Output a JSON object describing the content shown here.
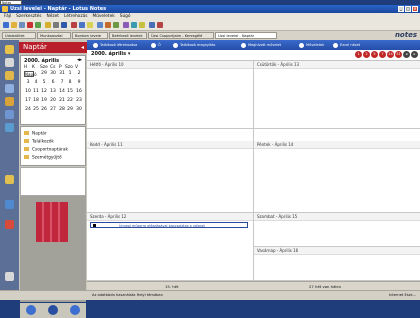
{
  "corner_label": "Notes",
  "window": {
    "title": "Uzsi levelei - Naptár - Lotus Notes"
  },
  "menu": [
    "Fájl",
    "Szerkesztés",
    "Nézet",
    "Létrehozás",
    "Műveletek",
    "Súgó"
  ],
  "tabs": [
    {
      "label": "Üdvözöllek",
      "active": false
    },
    {
      "label": "Munkaasztal",
      "active": false
    },
    {
      "label": "Bontom levele",
      "active": false
    },
    {
      "label": "Beérkező levelek",
      "active": false
    },
    {
      "label": "Üzsi Csoportjaim - Keresgélé",
      "active": false
    },
    {
      "label": "Uzsi levelei - Naptár",
      "active": true
    }
  ],
  "logo": "notes",
  "sidebar": {
    "title": "Naptár",
    "minical": {
      "month_label": "2000. április",
      "today_button": "Napló",
      "weekdays": [
        "H",
        "K",
        "Sze",
        "Cs",
        "P",
        "Szo",
        "V"
      ],
      "rows": [
        [
          "",
          "",
          "29",
          "30",
          "31",
          "1",
          "2"
        ],
        [
          "3",
          "4",
          "5",
          "6",
          "7",
          "8",
          "9"
        ],
        [
          "10",
          "11",
          "12",
          "13",
          "14",
          "15",
          "16"
        ],
        [
          "17",
          "18",
          "19",
          "20",
          "21",
          "22",
          "23"
        ],
        [
          "24",
          "25",
          "26",
          "27",
          "28",
          "29",
          "30"
        ]
      ]
    },
    "folders": [
      "Naptár",
      "Találkozók",
      "Csoportnaptárak",
      "Szemétgyűjtő"
    ]
  },
  "actions": [
    "Találkozó létrehozása",
    "Ő",
    "Találkozó megnyitás",
    "Meghívott művelet",
    "Műveletek",
    "Excel nézet"
  ],
  "month_view_label": "2000. április",
  "days": [
    {
      "label": "Hétfő - Április 10"
    },
    {
      "label": "Csütörtök - Április 13"
    },
    {
      "label": "Kedd - Április 11"
    },
    {
      "label": "Péntek - Április 14"
    },
    {
      "label": "Szerda - Április 12"
    },
    {
      "label": "Szombat - Április 15"
    },
    {
      "label": "Vasárnap - Április 16"
    }
  ],
  "entry_text": "Ünnepi műsorra előadásával kapcsolatos a választ",
  "week_footer": {
    "left": "15. hét",
    "right": "27 hét van hátra"
  },
  "status": {
    "message": "Az adatbázis használata Helyi témában",
    "zone": "Internet Eszk..."
  },
  "colors": {
    "accent": "#2a64c8",
    "sidebar_title": "#b91f2a"
  }
}
